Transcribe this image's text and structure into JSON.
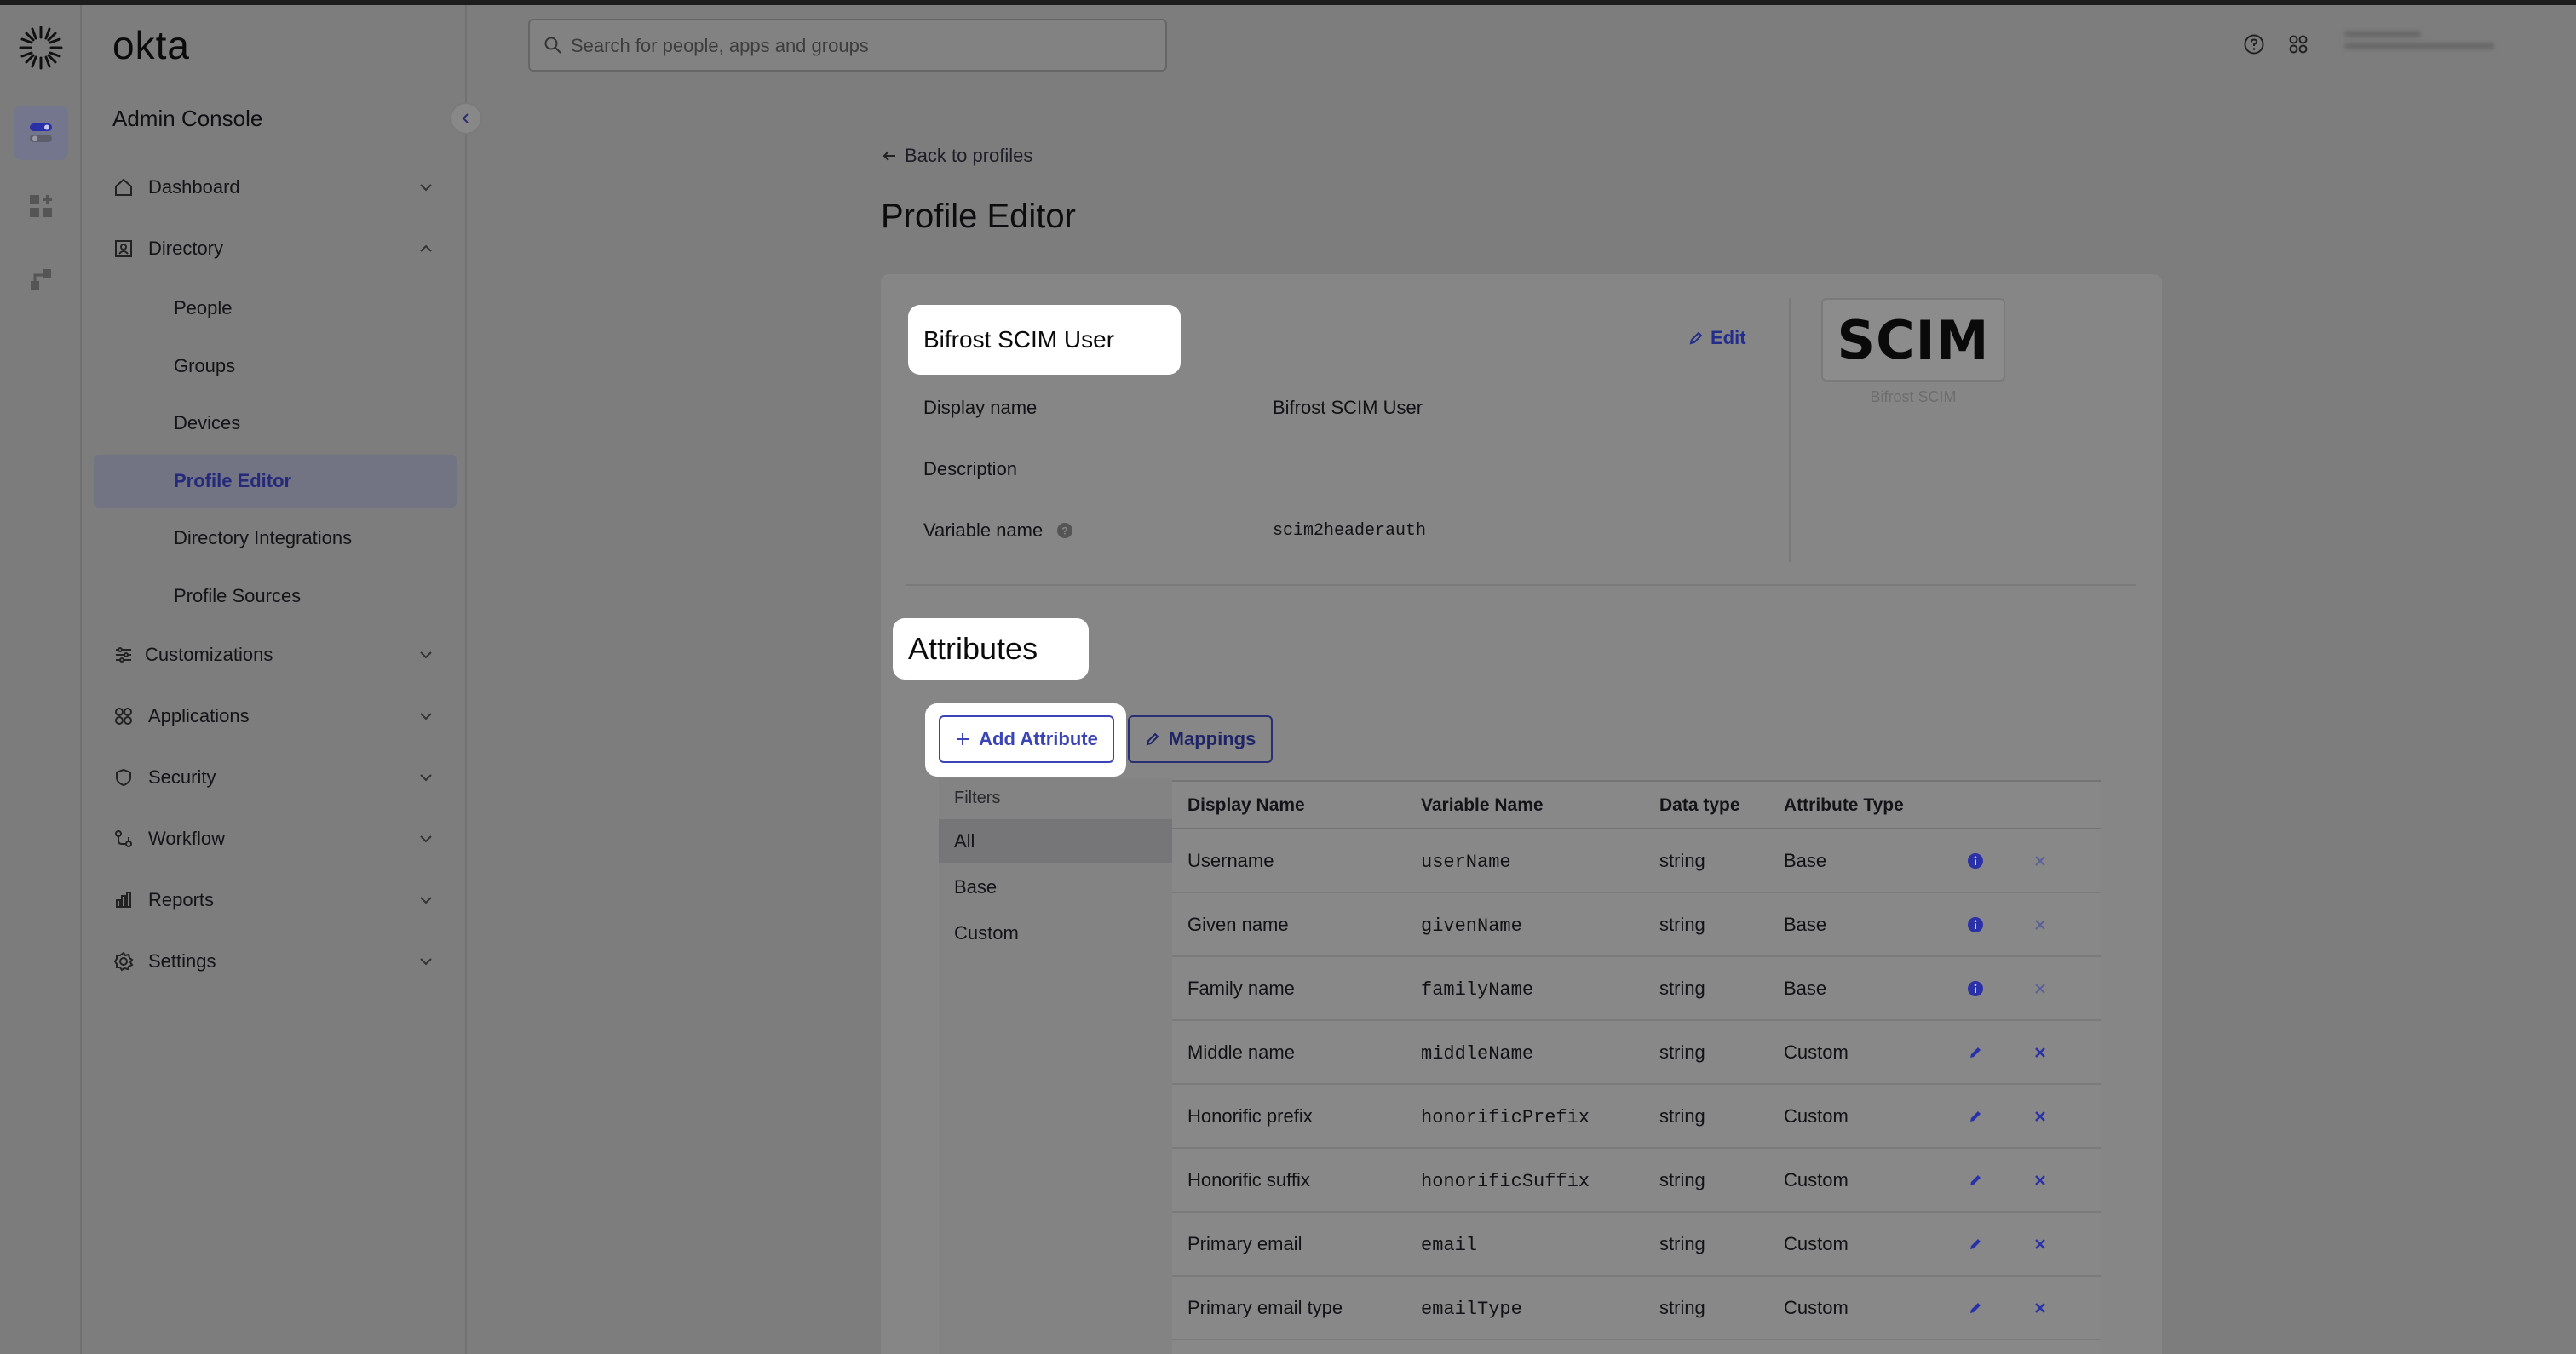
{
  "brand": {
    "name": "okta"
  },
  "sidebar": {
    "title": "Admin Console",
    "items": [
      {
        "label": "Dashboard"
      },
      {
        "label": "Directory"
      },
      {
        "label": "Customizations"
      },
      {
        "label": "Applications"
      },
      {
        "label": "Security"
      },
      {
        "label": "Workflow"
      },
      {
        "label": "Reports"
      },
      {
        "label": "Settings"
      }
    ],
    "directory_sub": [
      {
        "label": "People"
      },
      {
        "label": "Groups"
      },
      {
        "label": "Devices"
      },
      {
        "label": "Profile Editor"
      },
      {
        "label": "Directory Integrations"
      },
      {
        "label": "Profile Sources"
      }
    ]
  },
  "header": {
    "search_placeholder": "Search for people, apps and groups"
  },
  "content": {
    "back_link": "Back to profiles",
    "page_title": "Profile Editor",
    "profile_name": "Bifrost SCIM User",
    "edit_label": "Edit",
    "fields": {
      "display_name_label": "Display name",
      "display_name_value": "Bifrost SCIM User",
      "description_label": "Description",
      "variable_name_label": "Variable name",
      "variable_name_value": "scim2headerauth"
    },
    "logo_text": "SCIM",
    "logo_caption": "Bifrost SCIM",
    "attributes_title": "Attributes",
    "add_attribute_label": "Add Attribute",
    "mappings_label": "Mappings",
    "filters": {
      "title": "Filters",
      "options": [
        "All",
        "Base",
        "Custom"
      ]
    },
    "table": {
      "headers": [
        "Display Name",
        "Variable Name",
        "Data type",
        "Attribute Type"
      ],
      "rows": [
        {
          "display": "Username",
          "variable": "userName",
          "type": "string",
          "attr": "Base"
        },
        {
          "display": "Given name",
          "variable": "givenName",
          "type": "string",
          "attr": "Base"
        },
        {
          "display": "Family name",
          "variable": "familyName",
          "type": "string",
          "attr": "Base"
        },
        {
          "display": "Middle name",
          "variable": "middleName",
          "type": "string",
          "attr": "Custom"
        },
        {
          "display": "Honorific prefix",
          "variable": "honorificPrefix",
          "type": "string",
          "attr": "Custom"
        },
        {
          "display": "Honorific suffix",
          "variable": "honorificSuffix",
          "type": "string",
          "attr": "Custom"
        },
        {
          "display": "Primary email",
          "variable": "email",
          "type": "string",
          "attr": "Custom"
        },
        {
          "display": "Primary email type",
          "variable": "emailType",
          "type": "string",
          "attr": "Custom"
        }
      ]
    }
  },
  "colors": {
    "accent": "#3b44b5",
    "overlay": "#7d7d7d",
    "highlight": "#ffffff"
  }
}
